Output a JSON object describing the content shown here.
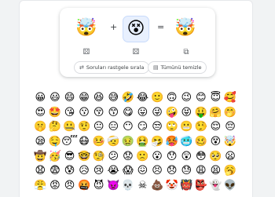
{
  "mixer": {
    "left_emoji": "🤯",
    "middle_emoji": "😵",
    "result_emoji": "🤯",
    "plus": "+",
    "equals": "=",
    "controls": {
      "left_icon": "⚄",
      "middle_icon": "⚄",
      "result_icon": "⧉"
    },
    "buttons": {
      "shuffle_icon": "⇄",
      "shuffle_label": "Soruları rastgele sırala",
      "clear_icon": "▤",
      "clear_label": "Tümünü temizle"
    }
  },
  "emoji_grid": [
    "😀",
    "😃",
    "😄",
    "😁",
    "😆",
    "😅",
    "🤣",
    "😂",
    "🙂",
    "🙃",
    "😉",
    "😊",
    "😇",
    "🥰",
    "😍",
    "🤩",
    "😘",
    "😗",
    "😚",
    "😙",
    "😋",
    "😛",
    "😜",
    "🤪",
    "😝",
    "🤑",
    "🤗",
    "🤭",
    "🤫",
    "🤔",
    "🤐",
    "🤨",
    "😐",
    "😑",
    "😶",
    "😏",
    "😒",
    "🙄",
    "😬",
    "🤥",
    "😌",
    "😔",
    "😪",
    "🤤",
    "😴",
    "😷",
    "🤒",
    "🤕",
    "🤢",
    "🤮",
    "🤧",
    "🥵",
    "🥶",
    "🥴",
    "😵",
    "🤯",
    "🤠",
    "🥳",
    "😎",
    "🤓",
    "🧐",
    "😕",
    "😟",
    "🙁",
    "😮",
    "😯",
    "😲",
    "😳",
    "🥺",
    "😦",
    "😧",
    "😨",
    "😰",
    "😥",
    "😢",
    "😭",
    "😱",
    "😖",
    "😣",
    "😞",
    "😓",
    "😩",
    "😫",
    "🥱",
    "😤",
    "😡",
    "😠",
    "🤬",
    "😈",
    "👿",
    "💀",
    "☠",
    "💩",
    "🤡",
    "👹",
    "👺",
    "👻",
    "👽"
  ]
}
